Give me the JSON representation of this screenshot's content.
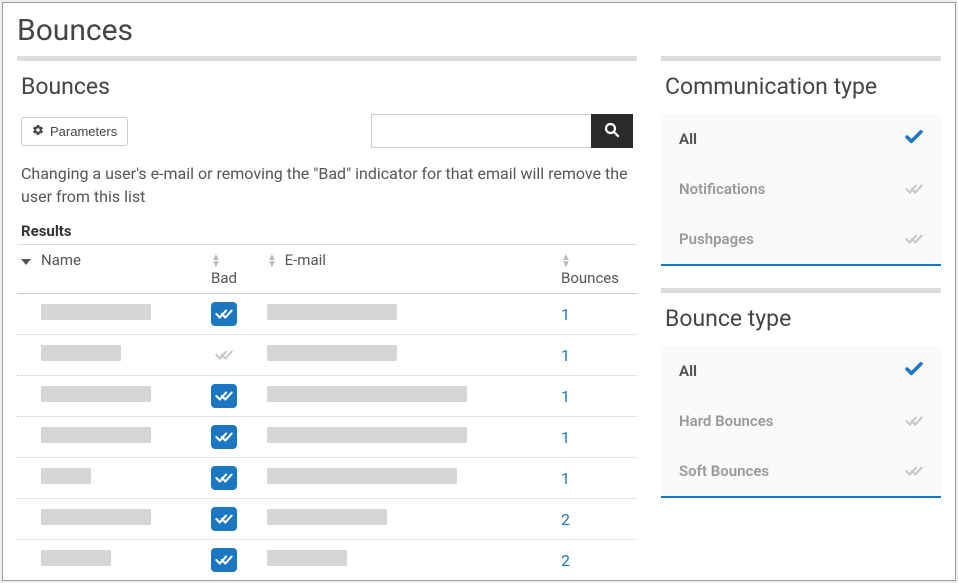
{
  "page": {
    "title": "Bounces"
  },
  "main": {
    "title": "Bounces",
    "parameters_label": "Parameters",
    "search": {
      "value": "",
      "placeholder": ""
    },
    "help_text": "Changing a user's e-mail or removing the \"Bad\" indicator for that email will remove the user from this list",
    "results_label": "Results",
    "columns": {
      "name": "Name",
      "bad": "Bad",
      "email": "E-mail",
      "bounces": "Bounces"
    },
    "rows": [
      {
        "name_w": 110,
        "bad": true,
        "email_w": 130,
        "bounces": "1"
      },
      {
        "name_w": 80,
        "bad": false,
        "email_w": 130,
        "bounces": "1"
      },
      {
        "name_w": 110,
        "bad": true,
        "email_w": 200,
        "bounces": "1"
      },
      {
        "name_w": 110,
        "bad": true,
        "email_w": 200,
        "bounces": "1"
      },
      {
        "name_w": 50,
        "bad": true,
        "email_w": 190,
        "bounces": "1"
      },
      {
        "name_w": 110,
        "bad": true,
        "email_w": 120,
        "bounces": "2"
      },
      {
        "name_w": 70,
        "bad": true,
        "email_w": 80,
        "bounces": "2"
      }
    ]
  },
  "side": {
    "comm_type": {
      "title": "Communication type",
      "items": [
        {
          "label": "All",
          "selected": true
        },
        {
          "label": "Notifications",
          "selected": false
        },
        {
          "label": "Pushpages",
          "selected": false
        }
      ]
    },
    "bounce_type": {
      "title": "Bounce type",
      "items": [
        {
          "label": "All",
          "selected": true
        },
        {
          "label": "Hard Bounces",
          "selected": false
        },
        {
          "label": "Soft Bounces",
          "selected": false
        }
      ]
    }
  }
}
